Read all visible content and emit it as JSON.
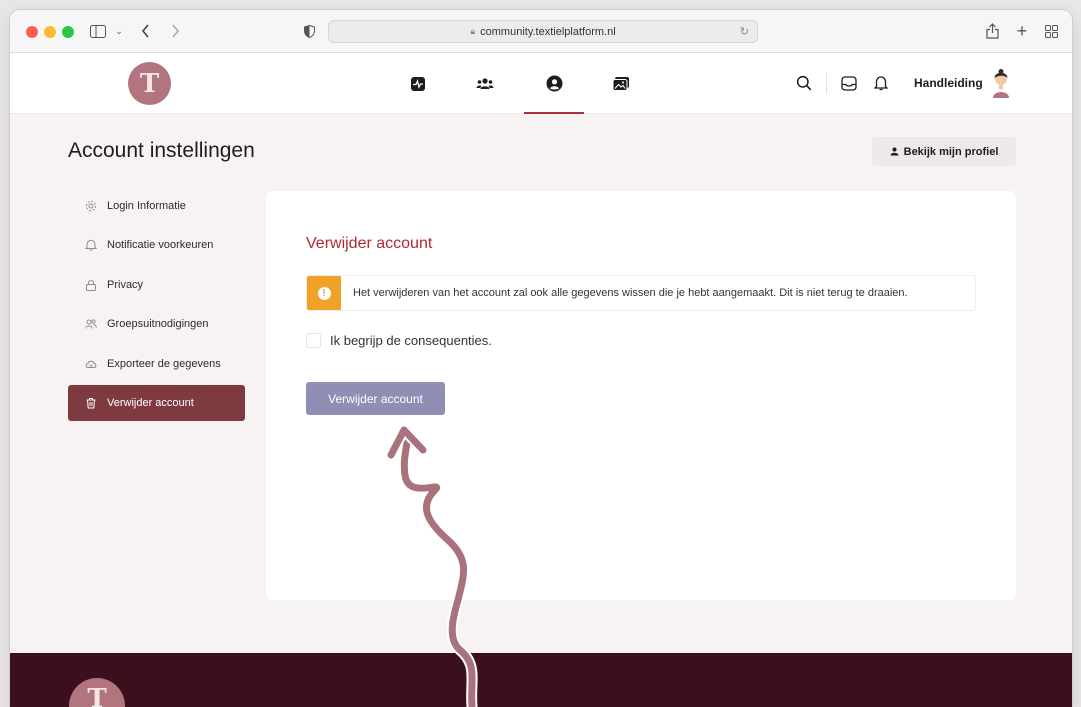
{
  "browser": {
    "url": "community.textielplatform.nl"
  },
  "header": {
    "logo_letter": "T",
    "nav": [
      {
        "name": "activity",
        "icon": "pulse-icon"
      },
      {
        "name": "groups",
        "icon": "users-icon"
      },
      {
        "name": "profile",
        "icon": "user-circle-icon",
        "active": true
      },
      {
        "name": "media",
        "icon": "photos-icon"
      }
    ],
    "user_name": "Handleiding"
  },
  "page": {
    "title": "Account instellingen",
    "profile_button": "Bekijk mijn profiel"
  },
  "sidebar": {
    "items": [
      {
        "label": "Login Informatie",
        "icon": "gear-icon"
      },
      {
        "label": "Notificatie voorkeuren",
        "icon": "bell-icon"
      },
      {
        "label": "Privacy",
        "icon": "lock-icon"
      },
      {
        "label": "Groepsuitnodigingen",
        "icon": "users-icon"
      },
      {
        "label": "Exporteer de gegevens",
        "icon": "cloud-download-icon"
      },
      {
        "label": "Verwijder account",
        "icon": "trash-icon",
        "active": true
      }
    ]
  },
  "card": {
    "title": "Verwijder account",
    "warning": "Het verwijderen van het account zal ook alle gegevens wissen die je hebt aangemaakt. Dit is niet terug te draaien.",
    "consent_label": "Ik begrijp de consequenties.",
    "delete_button": "Verwijder account"
  },
  "colors": {
    "accent": "#a8323f",
    "sidebar_active": "#7e3a3f",
    "warning": "#f0a127",
    "button": "#8f8fb6",
    "footer": "#3b0f1b",
    "annotation_arrow": "#a8737c"
  }
}
